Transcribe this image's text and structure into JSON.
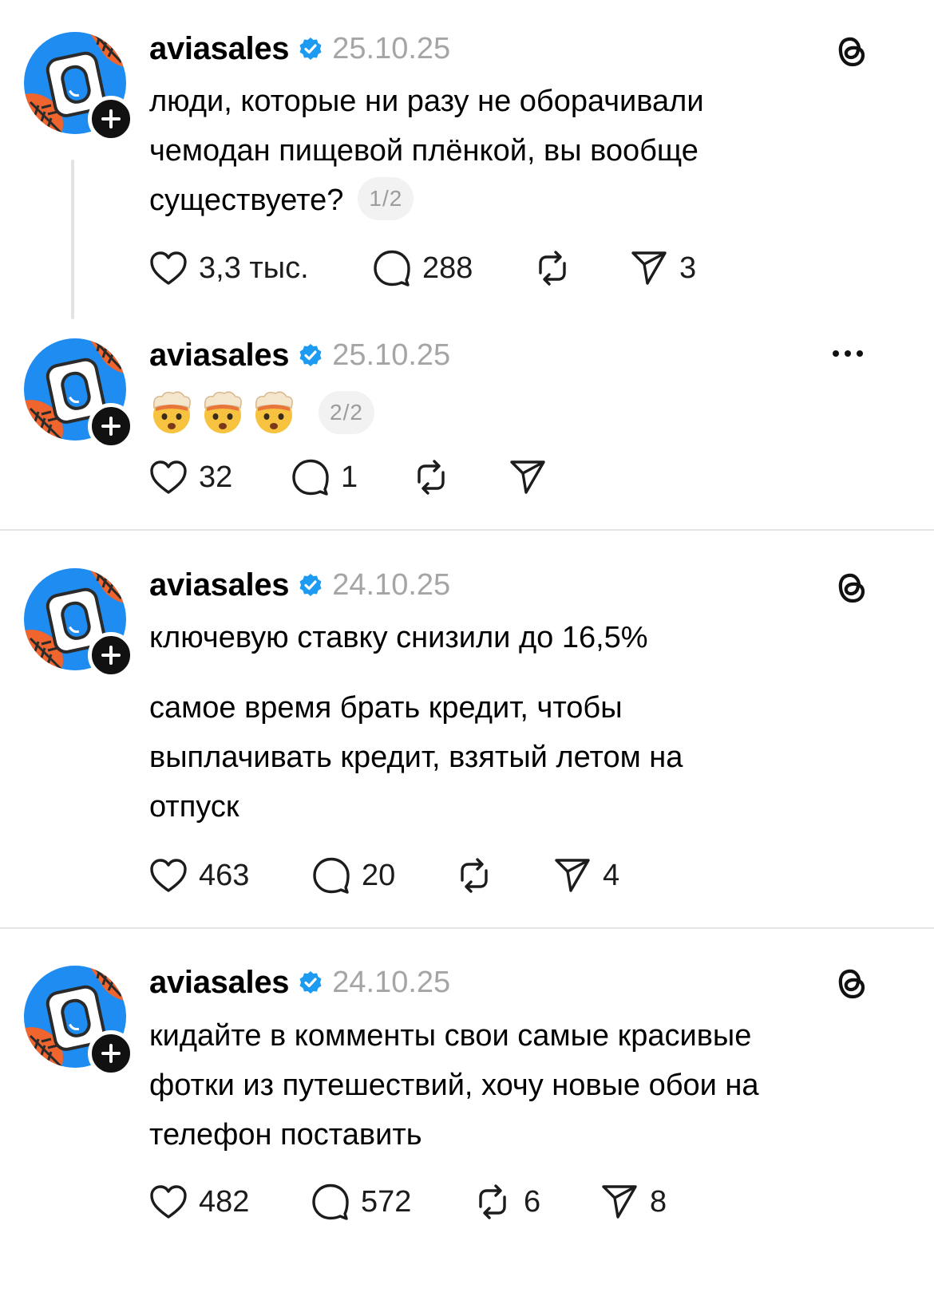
{
  "posts": [
    {
      "username": "aviasales",
      "date": "25.10.25",
      "lines": [
        "люди, которые ни разу не оборачивали",
        "чемодан пищевой плёнкой, вы вообще",
        "существуете?"
      ],
      "thread_counter": "1/2",
      "corner_icon": "threads-logo-icon",
      "likes": "3,3 тыс.",
      "comments": "288",
      "reposts": "",
      "shares": "3"
    },
    {
      "username": "aviasales",
      "date": "25.10.25",
      "emojis": [
        "🤯",
        "🤯",
        "🤯"
      ],
      "thread_counter": "2/2",
      "corner_icon": "more-options-icon",
      "likes": "32",
      "comments": "1",
      "reposts": "",
      "shares": ""
    },
    {
      "username": "aviasales",
      "date": "24.10.25",
      "lines": [
        "ключевую ставку снизили до 16,5%"
      ],
      "lines2": [
        "самое время брать кредит, чтобы",
        "выплачивать кредит, взятый летом на",
        "отпуск"
      ],
      "corner_icon": "threads-logo-icon",
      "likes": "463",
      "comments": "20",
      "reposts": "",
      "shares": "4"
    },
    {
      "username": "aviasales",
      "date": "24.10.25",
      "lines": [
        "кидайте в комменты свои самые красивые",
        "фотки из путешествий, хочу новые обои на",
        "телефон поставить"
      ],
      "corner_icon": "threads-logo-icon",
      "likes": "482",
      "comments": "572",
      "reposts": "6",
      "shares": "8"
    }
  ],
  "colors": {
    "avatar_blue": "#1e8cf0",
    "avatar_orange": "#f0642d",
    "verified_blue": "#1d9bf0",
    "date_gray": "#a5a5a5"
  }
}
